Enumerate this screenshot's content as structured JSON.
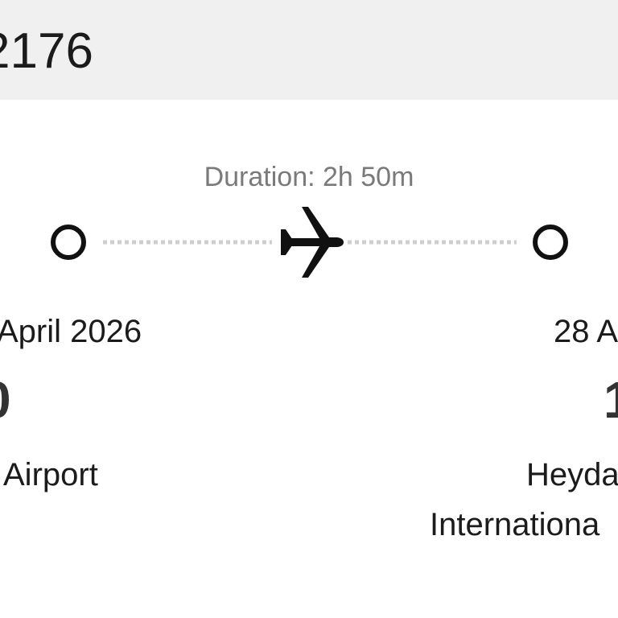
{
  "flight": {
    "number": "2176",
    "duration": "Duration: 2h 50m"
  },
  "departure": {
    "date": "April 2026",
    "time": "0",
    "airport": "Airport"
  },
  "arrival": {
    "date": "28 A",
    "time": "1",
    "airport_line1": "Heyda",
    "airport_line2": "Internationa"
  },
  "icons": {
    "route_start": "origin-circle-icon",
    "route_end": "destination-circle-icon",
    "plane": "airplane-icon"
  },
  "colors": {
    "header_bg": "#f0f0f0",
    "dotted_line": "#cfcfcf",
    "duration_text": "#7a7a7a",
    "primary_text": "#1b1b1b"
  }
}
